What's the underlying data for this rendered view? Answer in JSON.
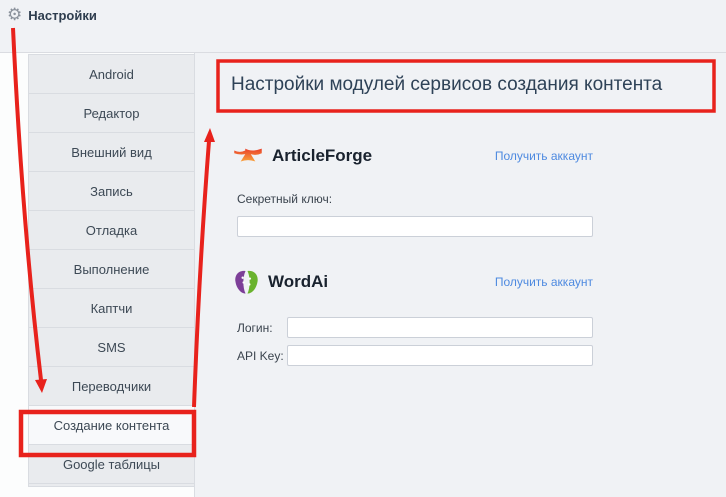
{
  "header": {
    "label": "Настройки",
    "icon": "gear-icon"
  },
  "sidebar": {
    "items": [
      {
        "label": "Android",
        "selected": false
      },
      {
        "label": "Редактор",
        "selected": false
      },
      {
        "label": "Внешний вид",
        "selected": false
      },
      {
        "label": "Запись",
        "selected": false
      },
      {
        "label": "Отладка",
        "selected": false
      },
      {
        "label": "Выполнение",
        "selected": false
      },
      {
        "label": "Каптчи",
        "selected": false
      },
      {
        "label": "SMS",
        "selected": false
      },
      {
        "label": "Переводчики",
        "selected": false
      },
      {
        "label": "Создание контента",
        "selected": true
      },
      {
        "label": "Google таблицы",
        "selected": false
      }
    ]
  },
  "content": {
    "title": "Настройки модулей сервисов создания контента",
    "modules": [
      {
        "name": "ArticleForge",
        "icon": "anvil-icon",
        "account_link": "Получить аккаунт",
        "fields": [
          {
            "label": "Секретный ключ:",
            "value": ""
          }
        ]
      },
      {
        "name": "WordAi",
        "icon": "brain-head-icon",
        "account_link": "Получить аккаунт",
        "fields": [
          {
            "label": "Логин:",
            "value": ""
          },
          {
            "label": "API Key:",
            "value": ""
          }
        ]
      }
    ]
  },
  "annotations": {
    "annotation_color": "#e8221c",
    "highlighted_sidebar_item": "Создание контента",
    "highlighted_title": "Настройки модулей сервисов создания контента"
  },
  "colors": {
    "background": "#f0f2f5",
    "link_blue": "#4e8ae0",
    "annotation_red": "#e8221c",
    "sidebar_item_bg": "#e9ebee",
    "articleforge_orange": "#f06a2a",
    "wordai_purple": "#7d3f98",
    "wordai_green": "#6ab32e"
  }
}
